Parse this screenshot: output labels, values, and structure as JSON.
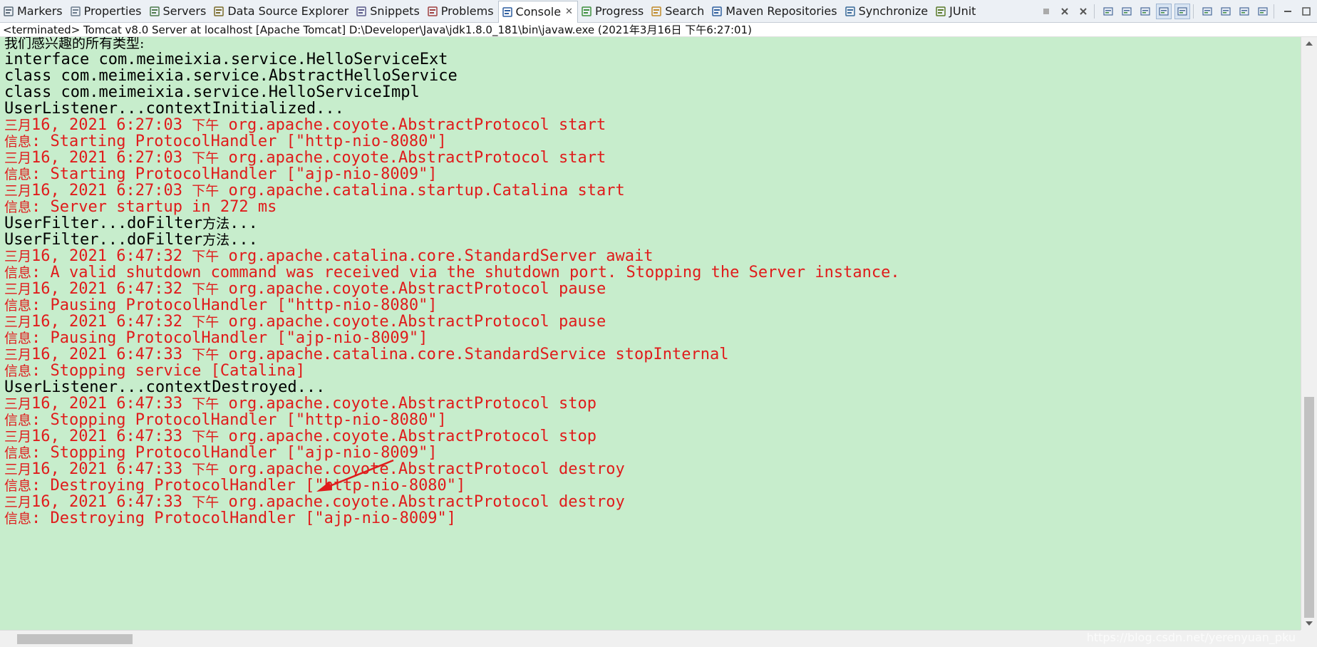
{
  "tabs": [
    {
      "label": "Markers",
      "icon": "markers-icon"
    },
    {
      "label": "Properties",
      "icon": "properties-icon"
    },
    {
      "label": "Servers",
      "icon": "servers-icon"
    },
    {
      "label": "Data Source Explorer",
      "icon": "data-source-icon"
    },
    {
      "label": "Snippets",
      "icon": "snippets-icon"
    },
    {
      "label": "Problems",
      "icon": "problems-icon"
    },
    {
      "label": "Console",
      "icon": "console-icon",
      "active": true,
      "close": "✕"
    },
    {
      "label": "Progress",
      "icon": "progress-icon"
    },
    {
      "label": "Search",
      "icon": "search-icon"
    },
    {
      "label": "Maven Repositories",
      "icon": "maven-icon"
    },
    {
      "label": "Synchronize",
      "icon": "synchronize-icon"
    },
    {
      "label": "JUnit",
      "icon": "junit-icon"
    }
  ],
  "status_line": "<terminated> Tomcat v8.0 Server at localhost [Apache Tomcat] D:\\Developer\\Java\\jdk1.8.0_181\\bin\\javaw.exe (2021年3月16日 下午6:27:01)",
  "colors": {
    "console_bg": "#c7edcc",
    "stdout": "#000000",
    "stderr": "#e01b1b",
    "annotation_arrow": "#e01b1b"
  },
  "console_lines": [
    {
      "type": "out",
      "parts": [
        {
          "cjk": true,
          "text": "我们感兴趣的所有类型:"
        }
      ]
    },
    {
      "type": "out",
      "parts": [
        {
          "text": "interface com.meimeixia.service.HelloServiceExt"
        }
      ]
    },
    {
      "type": "out",
      "parts": [
        {
          "text": "class com.meimeixia.service.AbstractHelloService"
        }
      ]
    },
    {
      "type": "out",
      "parts": [
        {
          "text": "class com.meimeixia.service.HelloServiceImpl"
        }
      ]
    },
    {
      "type": "out",
      "parts": [
        {
          "text": "UserListener...contextInitialized..."
        }
      ]
    },
    {
      "type": "err",
      "parts": [
        {
          "cjk": true,
          "text": "三月"
        },
        {
          "text": "16, 2021 6:27:03 "
        },
        {
          "cjk": true,
          "text": "下午"
        },
        {
          "text": " org.apache.coyote.AbstractProtocol start"
        }
      ]
    },
    {
      "type": "err",
      "parts": [
        {
          "cjk": true,
          "text": "信息"
        },
        {
          "text": ": Starting ProtocolHandler [\"http-nio-8080\"]"
        }
      ]
    },
    {
      "type": "err",
      "parts": [
        {
          "cjk": true,
          "text": "三月"
        },
        {
          "text": "16, 2021 6:27:03 "
        },
        {
          "cjk": true,
          "text": "下午"
        },
        {
          "text": " org.apache.coyote.AbstractProtocol start"
        }
      ]
    },
    {
      "type": "err",
      "parts": [
        {
          "cjk": true,
          "text": "信息"
        },
        {
          "text": ": Starting ProtocolHandler [\"ajp-nio-8009\"]"
        }
      ]
    },
    {
      "type": "err",
      "parts": [
        {
          "cjk": true,
          "text": "三月"
        },
        {
          "text": "16, 2021 6:27:03 "
        },
        {
          "cjk": true,
          "text": "下午"
        },
        {
          "text": " org.apache.catalina.startup.Catalina start"
        }
      ]
    },
    {
      "type": "err",
      "parts": [
        {
          "cjk": true,
          "text": "信息"
        },
        {
          "text": ": Server startup in 272 ms"
        }
      ]
    },
    {
      "type": "out",
      "parts": [
        {
          "text": "UserFilter...doFilter"
        },
        {
          "cjk": true,
          "text": "方法"
        },
        {
          "text": "..."
        }
      ]
    },
    {
      "type": "out",
      "parts": [
        {
          "text": "UserFilter...doFilter"
        },
        {
          "cjk": true,
          "text": "方法"
        },
        {
          "text": "..."
        }
      ]
    },
    {
      "type": "err",
      "parts": [
        {
          "cjk": true,
          "text": "三月"
        },
        {
          "text": "16, 2021 6:47:32 "
        },
        {
          "cjk": true,
          "text": "下午"
        },
        {
          "text": " org.apache.catalina.core.StandardServer await"
        }
      ]
    },
    {
      "type": "err",
      "parts": [
        {
          "cjk": true,
          "text": "信息"
        },
        {
          "text": ": A valid shutdown command was received via the shutdown port. Stopping the Server instance."
        }
      ]
    },
    {
      "type": "err",
      "parts": [
        {
          "cjk": true,
          "text": "三月"
        },
        {
          "text": "16, 2021 6:47:32 "
        },
        {
          "cjk": true,
          "text": "下午"
        },
        {
          "text": " org.apache.coyote.AbstractProtocol pause"
        }
      ]
    },
    {
      "type": "err",
      "parts": [
        {
          "cjk": true,
          "text": "信息"
        },
        {
          "text": ": Pausing ProtocolHandler [\"http-nio-8080\"]"
        }
      ]
    },
    {
      "type": "err",
      "parts": [
        {
          "cjk": true,
          "text": "三月"
        },
        {
          "text": "16, 2021 6:47:32 "
        },
        {
          "cjk": true,
          "text": "下午"
        },
        {
          "text": " org.apache.coyote.AbstractProtocol pause"
        }
      ]
    },
    {
      "type": "err",
      "parts": [
        {
          "cjk": true,
          "text": "信息"
        },
        {
          "text": ": Pausing ProtocolHandler [\"ajp-nio-8009\"]"
        }
      ]
    },
    {
      "type": "err",
      "parts": [
        {
          "cjk": true,
          "text": "三月"
        },
        {
          "text": "16, 2021 6:47:33 "
        },
        {
          "cjk": true,
          "text": "下午"
        },
        {
          "text": " org.apache.catalina.core.StandardService stopInternal"
        }
      ]
    },
    {
      "type": "err",
      "parts": [
        {
          "cjk": true,
          "text": "信息"
        },
        {
          "text": ": Stopping service [Catalina]"
        }
      ]
    },
    {
      "type": "out",
      "parts": [
        {
          "text": "UserListener...contextDestroyed..."
        }
      ]
    },
    {
      "type": "err",
      "parts": [
        {
          "cjk": true,
          "text": "三月"
        },
        {
          "text": "16, 2021 6:47:33 "
        },
        {
          "cjk": true,
          "text": "下午"
        },
        {
          "text": " org.apache.coyote.AbstractProtocol stop"
        }
      ]
    },
    {
      "type": "err",
      "parts": [
        {
          "cjk": true,
          "text": "信息"
        },
        {
          "text": ": Stopping ProtocolHandler [\"http-nio-8080\"]"
        }
      ]
    },
    {
      "type": "err",
      "parts": [
        {
          "cjk": true,
          "text": "三月"
        },
        {
          "text": "16, 2021 6:47:33 "
        },
        {
          "cjk": true,
          "text": "下午"
        },
        {
          "text": " org.apache.coyote.AbstractProtocol stop"
        }
      ]
    },
    {
      "type": "err",
      "parts": [
        {
          "cjk": true,
          "text": "信息"
        },
        {
          "text": ": Stopping ProtocolHandler [\"ajp-nio-8009\"]"
        }
      ]
    },
    {
      "type": "err",
      "parts": [
        {
          "cjk": true,
          "text": "三月"
        },
        {
          "text": "16, 2021 6:47:33 "
        },
        {
          "cjk": true,
          "text": "下午"
        },
        {
          "text": " org.apache.coyote.AbstractProtocol destroy"
        }
      ]
    },
    {
      "type": "err",
      "parts": [
        {
          "cjk": true,
          "text": "信息"
        },
        {
          "text": ": Destroying ProtocolHandler [\"http-nio-8080\"]"
        }
      ]
    },
    {
      "type": "err",
      "parts": [
        {
          "cjk": true,
          "text": "三月"
        },
        {
          "text": "16, 2021 6:47:33 "
        },
        {
          "cjk": true,
          "text": "下午"
        },
        {
          "text": " org.apache.coyote.AbstractProtocol destroy"
        }
      ]
    },
    {
      "type": "err",
      "parts": [
        {
          "cjk": true,
          "text": "信息"
        },
        {
          "text": ": Destroying ProtocolHandler [\"ajp-nio-8009\"]"
        }
      ]
    }
  ],
  "toolbar": {
    "buttons": [
      {
        "icon": "terminate-icon"
      },
      {
        "icon": "remove-launch-icon"
      },
      {
        "icon": "remove-all-terminated-icon"
      },
      {
        "icon": "clear-console-icon"
      },
      {
        "icon": "scroll-lock-icon"
      },
      {
        "icon": "word-wrap-icon"
      },
      {
        "icon": "show-stdout-icon",
        "selected": true
      },
      {
        "icon": "show-stderr-icon",
        "selected": true
      },
      {
        "icon": "pin-console-icon"
      },
      {
        "icon": "display-selected-console-icon"
      },
      {
        "icon": "open-console-icon"
      },
      {
        "icon": "view-menu-icon"
      },
      {
        "icon": "minimize-icon"
      },
      {
        "icon": "maximize-icon"
      }
    ]
  },
  "watermark": "https://blog.csdn.net/yerenyuan_pku"
}
